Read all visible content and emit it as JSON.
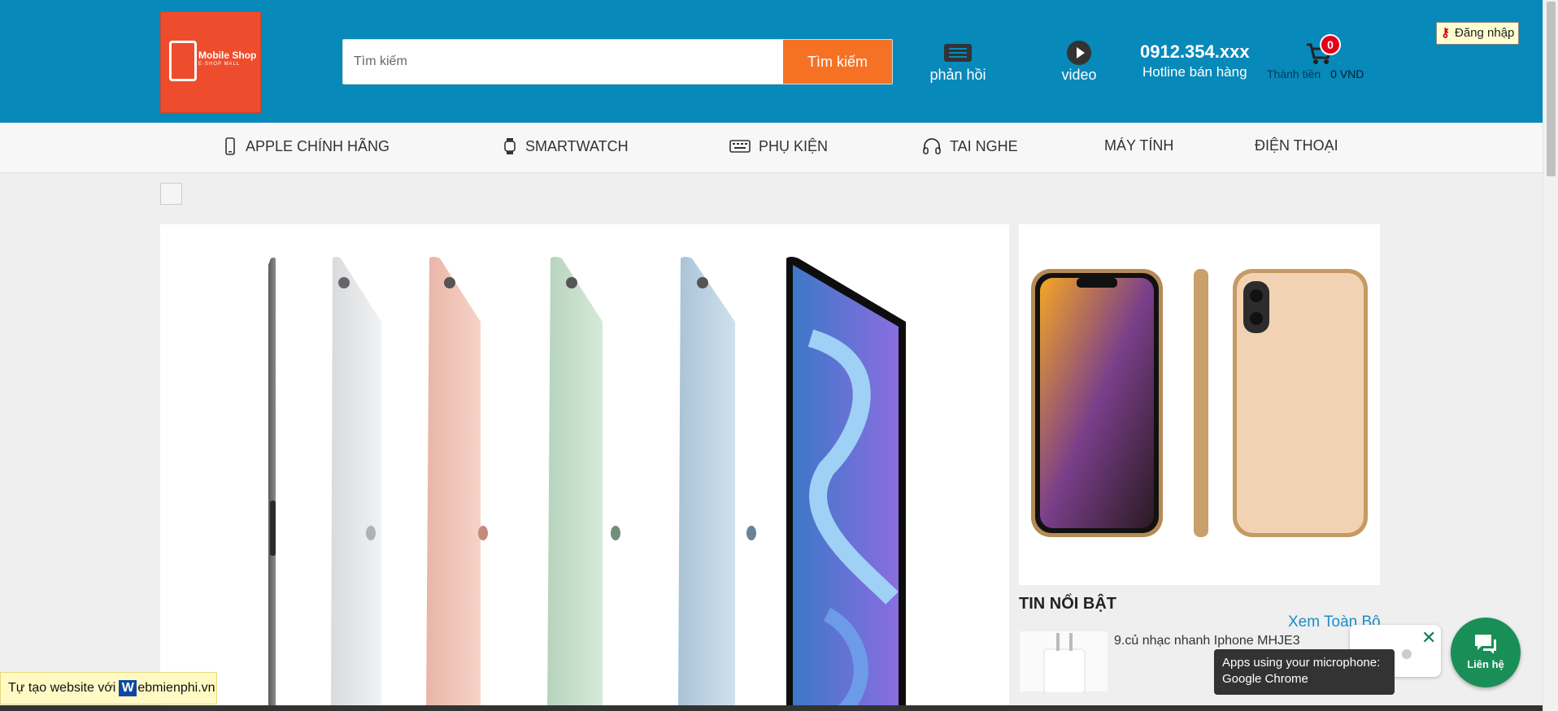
{
  "header": {
    "logo_text": "Mobile Shop",
    "logo_subtext": "E-SHOP MALL",
    "search_placeholder": "Tìm kiếm",
    "search_button": "Tìm kiếm",
    "feedback_label": "phản hồi",
    "video_label": "video",
    "phone": "0912.354.xxx",
    "hotline_label": "Hotline bán hàng",
    "cart_count": "0",
    "cart_total_label": "Thành tiền",
    "cart_total_value": "0 VND",
    "login_label": "Đăng nhập"
  },
  "nav": {
    "items": [
      {
        "label": "APPLE CHÍNH HÃNG",
        "icon": "phone-icon"
      },
      {
        "label": "SMARTWATCH",
        "icon": "watch-icon"
      },
      {
        "label": "PHỤ KIỆN",
        "icon": "keyboard-icon"
      },
      {
        "label": "TAI NGHE",
        "icon": "headphones-icon"
      },
      {
        "label": "MÁY TÍNH",
        "icon": ""
      },
      {
        "label": "ĐIỆN THOẠI",
        "icon": ""
      }
    ]
  },
  "news": {
    "title": "TIN NỔI BẬT",
    "see_all": "Xem Toàn Bộ",
    "items": [
      {
        "title": "9.củ nhạc nhanh Iphone MHJE3"
      }
    ]
  },
  "widgets": {
    "builder_prefix": "Tự tạo website với",
    "builder_w": "W",
    "builder_suffix": "ebmienphi.vn",
    "chat_label": "Liên hệ",
    "tooltip_line1": "Apps using your microphone:",
    "tooltip_line2": "Google Chrome"
  },
  "colors": {
    "header_bg": "#0789ba",
    "accent": "#f57224",
    "chat": "#1a8e57"
  }
}
